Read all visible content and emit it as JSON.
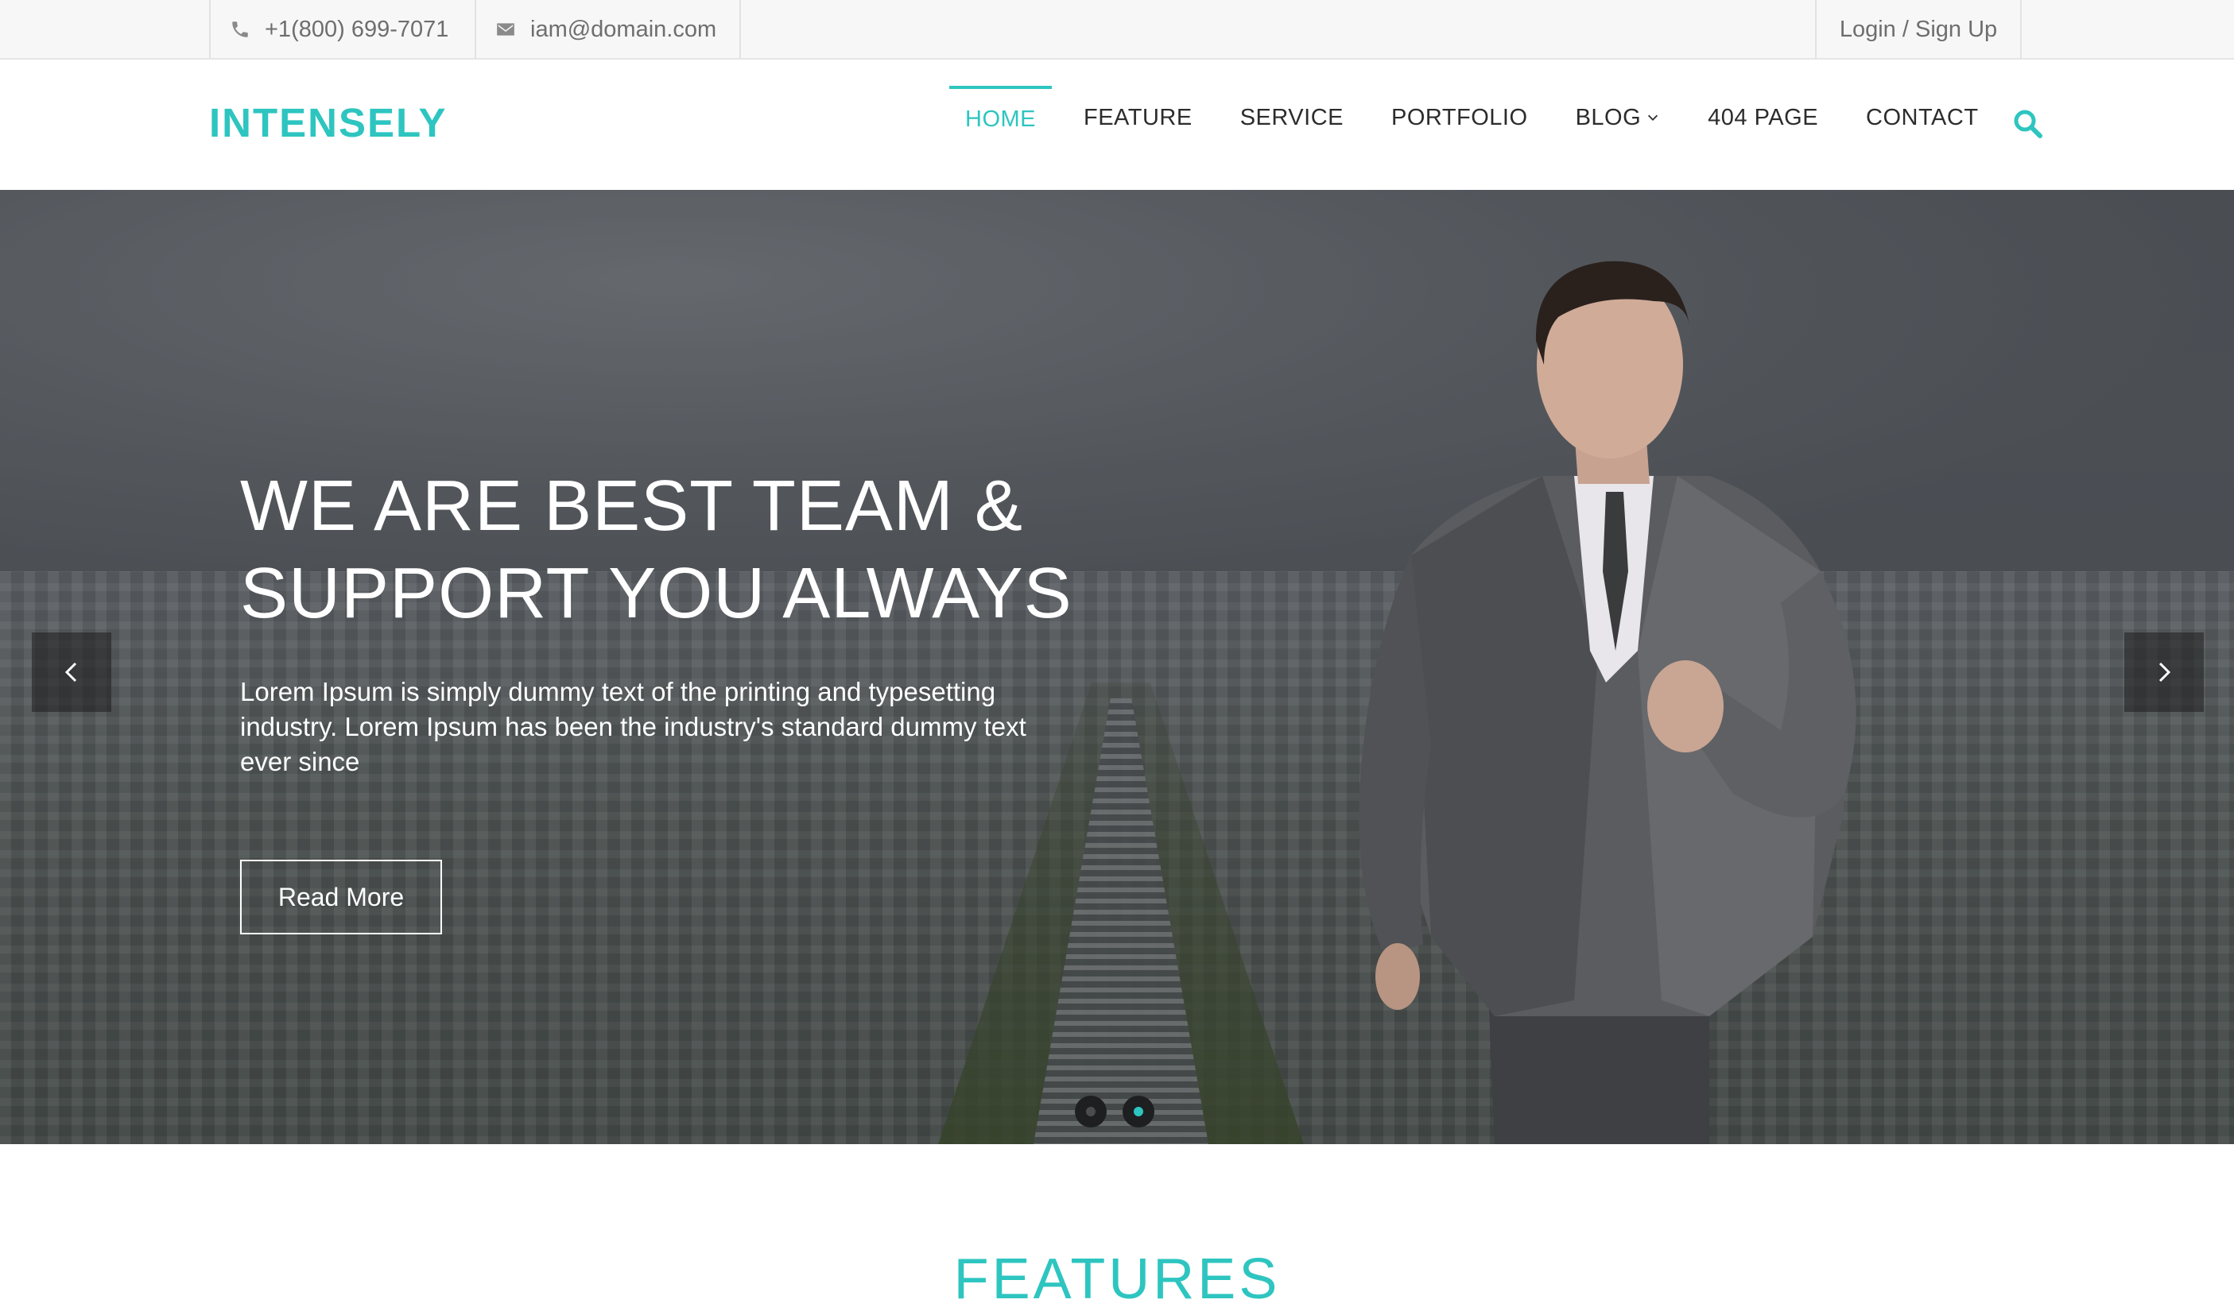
{
  "topbar": {
    "phone": "+1(800) 699-7071",
    "email": "iam@domain.com",
    "login": "Login / Sign Up",
    "phone_icon": "phone-icon",
    "email_icon": "envelope-icon"
  },
  "header": {
    "logo": "INTENSELY",
    "nav": [
      {
        "label": "HOME",
        "active": true
      },
      {
        "label": "FEATURE"
      },
      {
        "label": "SERVICE"
      },
      {
        "label": "PORTFOLIO"
      },
      {
        "label": "BLOG",
        "has_dropdown": true
      },
      {
        "label": "404 PAGE"
      },
      {
        "label": "CONTACT"
      }
    ],
    "search_icon": "search-icon"
  },
  "hero": {
    "title_line1": "WE ARE BEST TEAM &",
    "title_line2": "SUPPORT YOU ALWAYS",
    "text": "Lorem Ipsum is simply dummy text of the printing and typesetting industry. Lorem Ipsum has been the industry's standard dummy text ever since",
    "button": "Read More",
    "slides": 2,
    "active_slide": 2
  },
  "features": {
    "title": "FEATURES"
  },
  "colors": {
    "accent": "#2ec5c0",
    "topbar_bg": "#f7f7f7",
    "nav_text": "#2c2c2c"
  }
}
